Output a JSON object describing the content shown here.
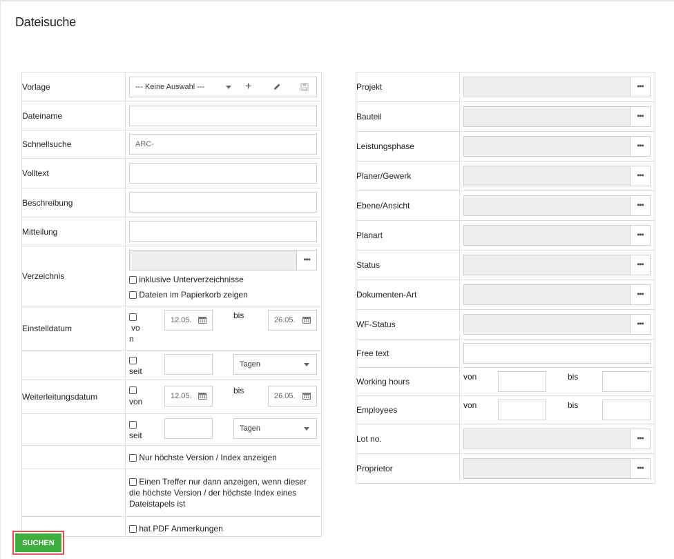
{
  "page": {
    "title": "Dateisuche"
  },
  "left": {
    "vorlage": {
      "label": "Vorlage",
      "value": "--- Keine Auswahl ---"
    },
    "dateiname": {
      "label": "Dateiname",
      "value": ""
    },
    "schnellsuche": {
      "label": "Schnellsuche",
      "value": "ARC-"
    },
    "volltext": {
      "label": "Volltext",
      "value": ""
    },
    "beschreibung": {
      "label": "Beschreibung",
      "value": ""
    },
    "mitteilung": {
      "label": "Mitteilung",
      "value": ""
    },
    "verzeichnis": {
      "label": "Verzeichnis",
      "browse": "•••",
      "opt_sub": "inklusive Unterverzeichnisse",
      "opt_trash": "Dateien im Papierkorb zeigen"
    },
    "einstelldatum": {
      "label": "Einstelldatum",
      "von_a": "vo",
      "von_b": "n",
      "from": "12.05.",
      "bis": "bis",
      "to": "26.05.",
      "seit": "seit",
      "days": "Tagen"
    },
    "weiterleitungsdatum": {
      "label": "Weiterleitungsdatum",
      "von": "von",
      "from": "12.05.",
      "bis": "bis",
      "to": "26.05.",
      "seit": "seit",
      "days": "Tagen"
    },
    "opt_latest": "Nur höchste Version / Index anzeigen",
    "opt_hit": "Einen Treffer nur dann anzeigen, wenn dieser die höchste Version / der höchste Index eines Dateistapels ist",
    "opt_pdf": "hat PDF Anmerkungen"
  },
  "right": {
    "dots": "•••",
    "projekt": "Projekt",
    "bauteil": "Bauteil",
    "leistungsphase": "Leistungsphase",
    "planer": "Planer/Gewerk",
    "ebene": "Ebene/Ansicht",
    "planart": "Planart",
    "status": "Status",
    "dokart": "Dokumenten-Art",
    "wfstatus": "WF-Status",
    "freetext": "Free text",
    "working": {
      "label": "Working hours",
      "von": "von",
      "bis": "bis"
    },
    "employees": {
      "label": "Employees",
      "von": "von",
      "bis": "bis"
    },
    "lotno": "Lot no.",
    "proprietor": "Proprietor"
  },
  "actions": {
    "search": "SUCHEN"
  },
  "colors": {
    "accent_green": "#3fae3f",
    "highlight_red": "#e05252",
    "disabled_bg": "#eeeeee"
  }
}
